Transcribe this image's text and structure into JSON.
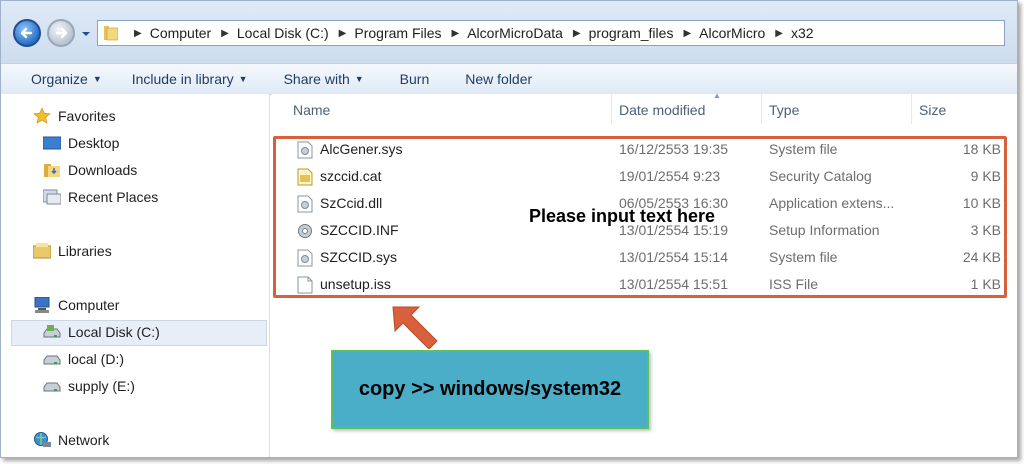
{
  "address": {
    "crumbs": [
      "Computer",
      "Local Disk (C:)",
      "Program Files",
      "AlcorMicroData",
      "program_files",
      "AlcorMicro",
      "x32"
    ]
  },
  "toolbar": {
    "organize": "Organize",
    "include_in_library": "Include in library",
    "share_with": "Share with",
    "burn": "Burn",
    "new_folder": "New folder"
  },
  "nav": {
    "favorites": "Favorites",
    "desktop": "Desktop",
    "downloads": "Downloads",
    "recent_places": "Recent Places",
    "libraries": "Libraries",
    "computer": "Computer",
    "local_c": "Local Disk (C:)",
    "local_d": "local (D:)",
    "supply_e": "supply (E:)",
    "network": "Network"
  },
  "columns": {
    "name": "Name",
    "date": "Date modified",
    "type": "Type",
    "size": "Size"
  },
  "files": [
    {
      "name": "AlcGener.sys",
      "date": "16/12/2553 19:35",
      "type": "System file",
      "size": "18 KB",
      "icon": "sys-file-icon"
    },
    {
      "name": "szccid.cat",
      "date": "19/01/2554 9:23",
      "type": "Security Catalog",
      "size": "9 KB",
      "icon": "catalog-file-icon"
    },
    {
      "name": "SzCcid.dll",
      "date": "06/05/2553 16:30",
      "type": "Application extens...",
      "size": "10 KB",
      "icon": "dll-file-icon"
    },
    {
      "name": "SZCCID.INF",
      "date": "13/01/2554 15:19",
      "type": "Setup Information",
      "size": "3 KB",
      "icon": "inf-file-icon"
    },
    {
      "name": "SZCCID.sys",
      "date": "13/01/2554 15:14",
      "type": "System file",
      "size": "24 KB",
      "icon": "sys-file-icon"
    },
    {
      "name": "unsetup.iss",
      "date": "13/01/2554 15:51",
      "type": "ISS File",
      "size": "1 KB",
      "icon": "generic-file-icon"
    }
  ],
  "annotations": {
    "overlay_text": "Please input text here",
    "callout": "copy >> windows/system32",
    "highlight_color": "#d9603c",
    "callout_bg": "#4aaec8",
    "callout_border": "#5cc05c"
  }
}
